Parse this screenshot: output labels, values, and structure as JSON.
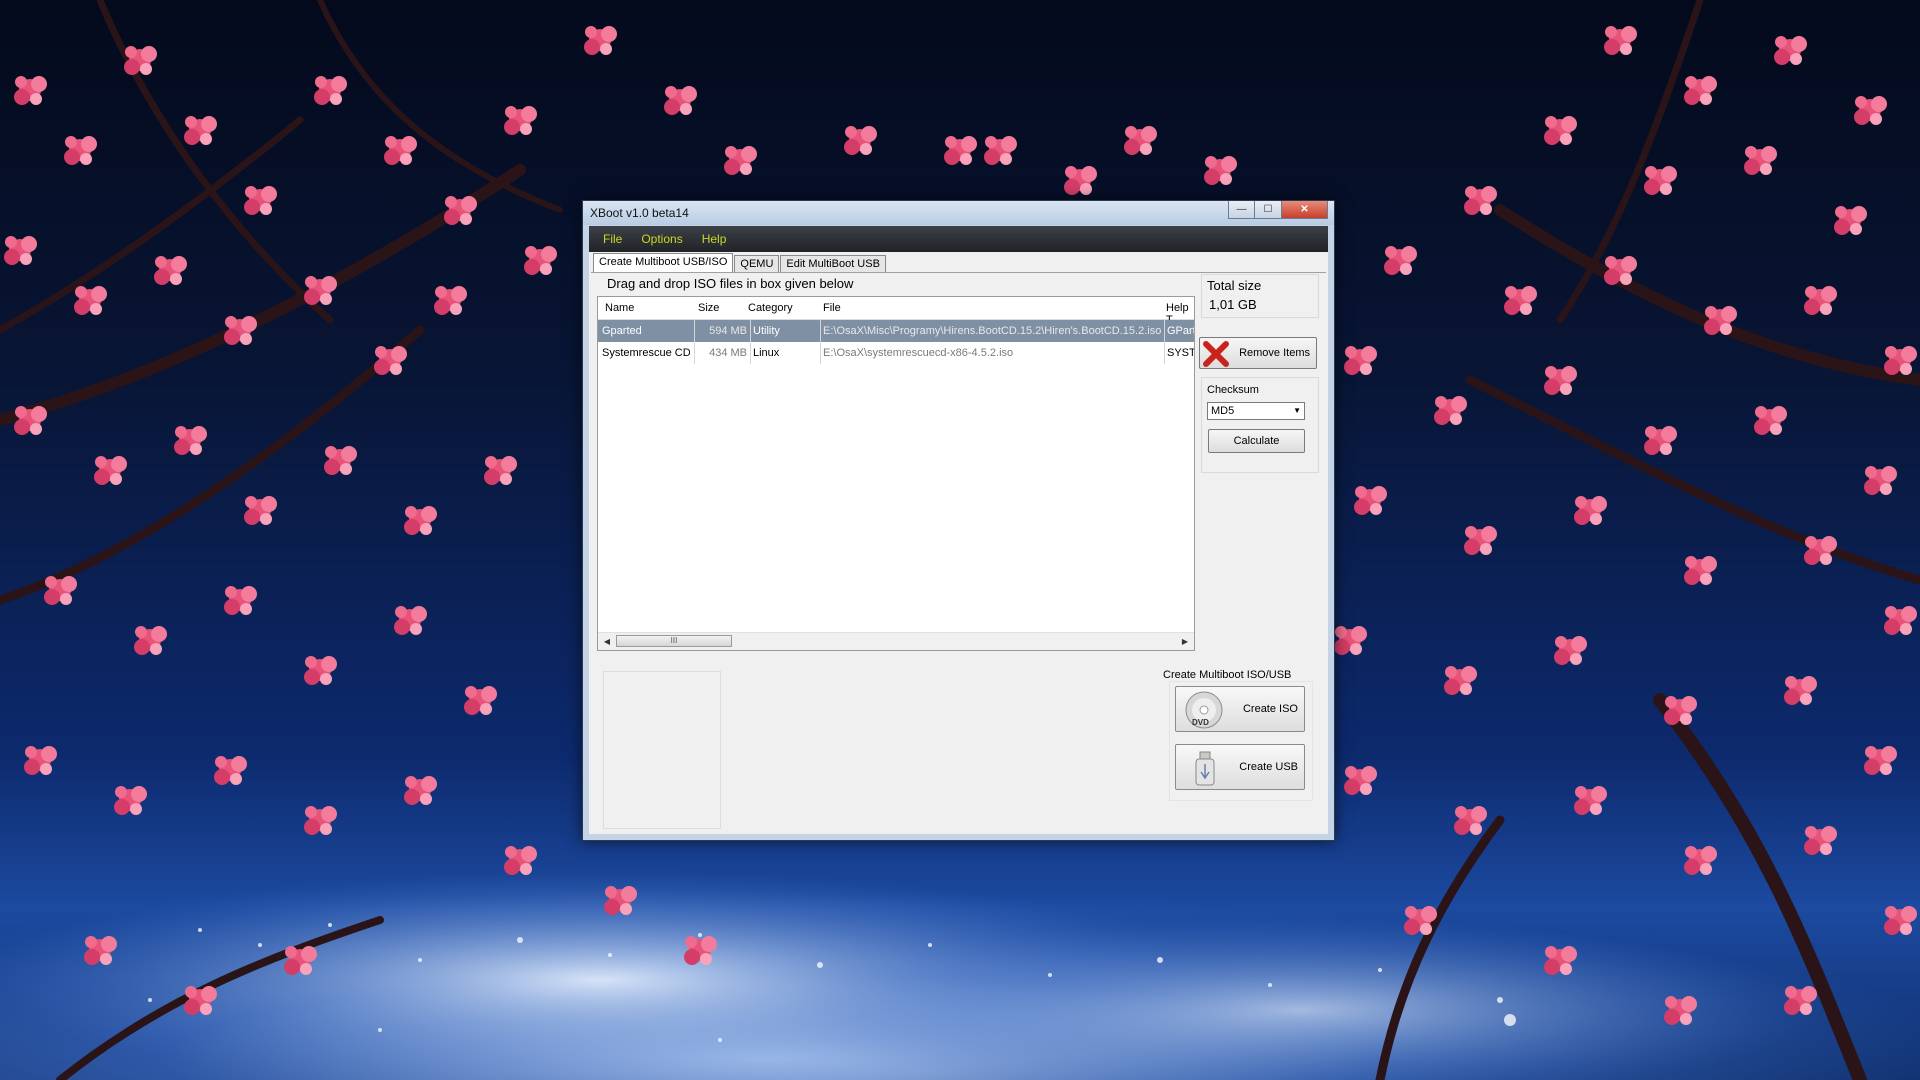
{
  "window": {
    "title": "XBoot v1.0 beta14",
    "caption": {
      "minimize": "—",
      "maximize": "☐",
      "close": "✕"
    }
  },
  "menu": {
    "file": "File",
    "options": "Options",
    "help": "Help"
  },
  "tabs": [
    {
      "label": "Create Multiboot USB/ISO",
      "active": true
    },
    {
      "label": "QEMU",
      "active": false
    },
    {
      "label": "Edit MultiBoot USB",
      "active": false
    }
  ],
  "main": {
    "drag_label": "Drag and drop ISO files in box given below",
    "columns": {
      "name": "Name",
      "size": "Size",
      "category": "Category",
      "file": "File",
      "help": "Help T"
    },
    "rows": [
      {
        "name": "Gparted",
        "size": "594 MB",
        "category": "Utility",
        "file": "E:\\OsaX\\Misc\\Programy\\Hirens.BootCD.15.2\\Hiren's.BootCD.15.2.iso",
        "help": "GParted"
      },
      {
        "name": "Systemrescue CD",
        "size": "434 MB",
        "category": "Linux",
        "file": "E:\\OsaX\\systemrescuecd-x86-4.5.2.iso",
        "help": "SYSTE"
      }
    ],
    "scroll_thumb_grip": "III"
  },
  "side": {
    "total_size_label": "Total size",
    "total_size_value": "1,01 GB",
    "remove_items": "Remove Items",
    "checksum_label": "Checksum",
    "checksum_value": "MD5",
    "calculate": "Calculate",
    "create_group_label": "Create Multiboot ISO/USB",
    "create_iso": "Create ISO",
    "create_usb": "Create USB",
    "dvd_icon_text": "DVD"
  },
  "colors": {
    "menu_text": "#c9d825",
    "selected_row": "#7f8fa4",
    "remove_x": "#c8241c"
  }
}
